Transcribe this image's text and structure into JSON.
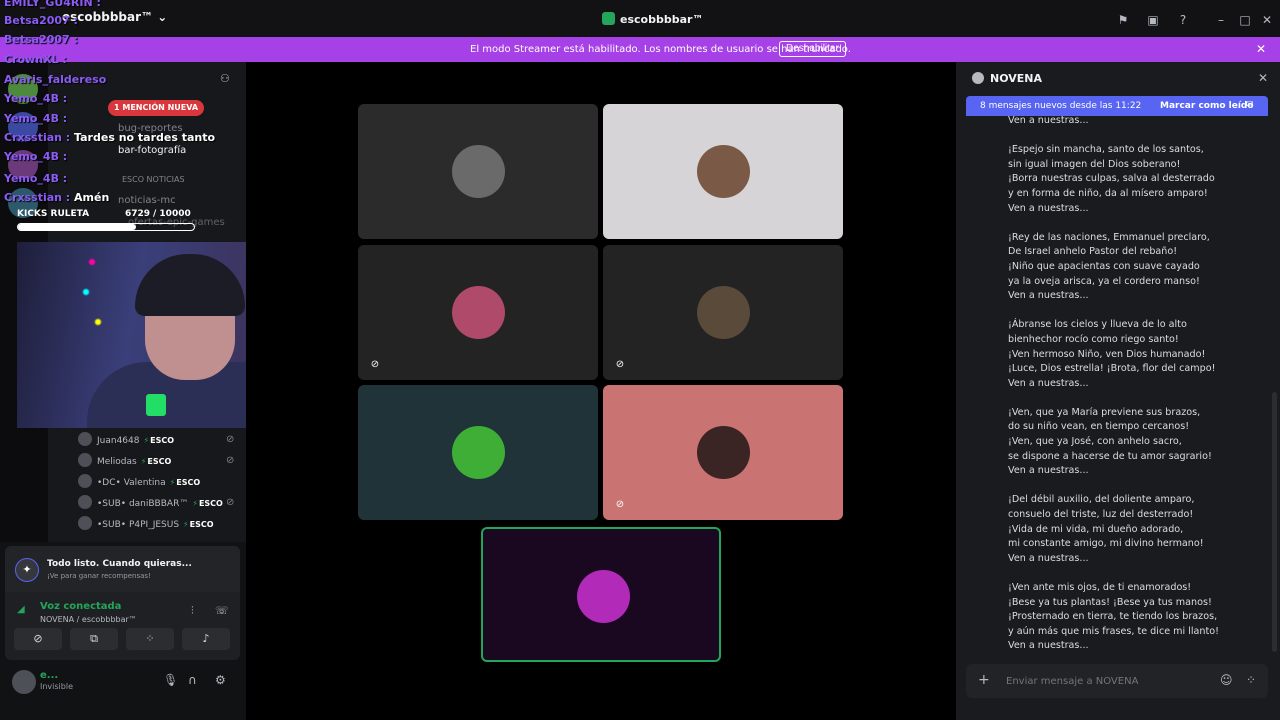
{
  "window": {
    "title": "escobbbbar™"
  },
  "banner": {
    "text": "El modo Streamer está habilitado. Los nombres de usuario se han truncado.",
    "button": "Deshabilitar"
  },
  "sidebar": {
    "server_name": "escobbbbar™",
    "mention_pill": "1 MENCIÓN NUEVA",
    "channels": [
      "bug-reportes",
      "bar-fotografía",
      "ESCO NOTICIAS",
      "noticias-mc",
      "ofertas-epic-games"
    ],
    "voice_users": [
      {
        "name": "Juan4648",
        "tag": "ESCO",
        "muted": true
      },
      {
        "name": "Meliodas",
        "tag": "ESCO",
        "muted": true
      },
      {
        "name": "•DC• Valentina",
        "tag": "ESCO",
        "muted": false
      },
      {
        "name": "•SUB• daniBBBAR™",
        "tag": "ESCO",
        "muted": true
      },
      {
        "name": "•SUB• P4PI_JESUS",
        "tag": "ESCO",
        "muted": false
      }
    ]
  },
  "overlay": {
    "messages": [
      {
        "user": "EMILY_GU4RIN :",
        "text": ""
      },
      {
        "user": "Betsa2007 :",
        "text": ""
      },
      {
        "user": "Betsa2007 :",
        "text": ""
      },
      {
        "user": "CrownXL :",
        "text": ""
      },
      {
        "user": "Avaris_faldereso",
        "text": ""
      },
      {
        "user": "Yemo_4B :",
        "text": ""
      },
      {
        "user": "Yemo_4B :",
        "text": ""
      },
      {
        "user": "Crxsstian :",
        "text": "Tardes no tardes tanto"
      },
      {
        "user": "Yemo_4B :",
        "text": ""
      },
      {
        "user": "Yemo_4B :",
        "text": ""
      },
      {
        "user": "Crxsstian :",
        "text": "Amén"
      }
    ],
    "kicks_label": "KICKS RULETA",
    "kicks_value": "6729",
    "kicks_goal": "/ 10000",
    "kicks_progress": 0.6729
  },
  "voice_panel": {
    "quest_title": "Todo listo. Cuando quieras...",
    "quest_sub": "¡Ve para ganar recompensas!",
    "status": "Voz conectada",
    "channel": "NOVENA / escobbbbar™"
  },
  "user_panel": {
    "name": "e...",
    "status": "Invisible"
  },
  "tiles": [
    {
      "bg": "#2b2b2b",
      "avatar": "#6a6a6a",
      "muted": false,
      "speaking": false
    },
    {
      "bg": "#d6d4d6",
      "avatar": "#7a5a46",
      "muted": false,
      "speaking": false
    },
    {
      "bg": "#232323",
      "avatar": "#b04a6a",
      "muted": true,
      "speaking": false
    },
    {
      "bg": "#232323",
      "avatar": "#5a4a3a",
      "muted": true,
      "speaking": false
    },
    {
      "bg": "#1f3338",
      "avatar": "#3fae36",
      "muted": false,
      "speaking": false
    },
    {
      "bg": "#c97373",
      "avatar": "#3a2424",
      "muted": true,
      "speaking": false
    },
    {
      "bg": "#1a0820",
      "avatar": "#b22ab8",
      "muted": false,
      "speaking": true
    }
  ],
  "chat": {
    "title": "NOVENA",
    "new_messages": "8 mensajes nuevos desde las 11:22",
    "mark_read": "Marcar como leído",
    "input_placeholder": "Enviar mensaje a NOVENA",
    "top_line": "Ven a nuestras...",
    "stanzas": [
      [
        "¡Espejo sin mancha, santo de los santos,",
        "sin igual imagen del Dios soberano!",
        "¡Borra nuestras culpas, salva al desterrado",
        "y en forma de niño, da al mísero amparo!",
        "Ven a nuestras..."
      ],
      [
        "¡Rey de las naciones, Emmanuel preclaro,",
        "De Israel anhelo Pastor del rebaño!",
        "¡Niño que apacientas con suave cayado",
        "ya la oveja arisca, ya el cordero manso!",
        "Ven a nuestras..."
      ],
      [
        "¡Ábranse los cielos y llueva de lo alto",
        "bienhechor rocío como riego santo!",
        "¡Ven hermoso Niño, ven Dios humanado!",
        "¡Luce, Dios estrella! ¡Brota, flor del campo!",
        "Ven a nuestras..."
      ],
      [
        "¡Ven, que ya María previene sus brazos,",
        "do su niño vean, en tiempo cercanos!",
        "¡Ven, que ya José, con anhelo sacro,",
        "se dispone a hacerse de tu amor sagrario!",
        "Ven a nuestras..."
      ],
      [
        "¡Del débil auxilio, del doliente amparo,",
        "consuelo del triste, luz del desterrado!",
        "¡Vida de mi vida, mi dueño adorado,",
        "mi constante amigo, mi divino hermano!",
        "Ven a nuestras..."
      ],
      [
        "¡Ven ante mis ojos, de ti enamorados!",
        "¡Bese ya tus plantas! ¡Bese ya tus manos!",
        "¡Prosternado en tierra, te tiendo los brazos,",
        "y aún más que mis frases, te dice mi llanto!",
        "Ven a nuestras..."
      ]
    ]
  },
  "colors": {
    "banner": "#a541e6",
    "accent": "#5865f2",
    "online": "#23a55a"
  }
}
